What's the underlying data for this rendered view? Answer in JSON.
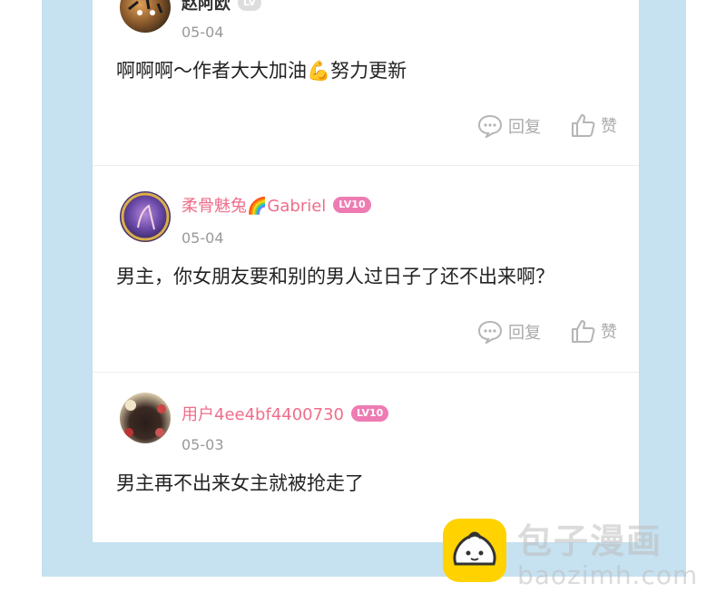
{
  "comments": [
    {
      "username": "赵阿欧",
      "level": "LV",
      "date": "05-04",
      "text": "啊啊啊～作者大大加油💪努力更新",
      "reply_label": "回复",
      "like_label": "赞"
    },
    {
      "username": "柔骨魅兔🌈Gabriel",
      "level": "LV10",
      "date": "05-04",
      "text": "男主，你女朋友要和别的男人过日子了还不出来啊？",
      "reply_label": "回复",
      "like_label": "赞"
    },
    {
      "username": "用户4ee4bf4400730",
      "level": "LV10",
      "date": "05-03",
      "text": "男主再不出来女主就被抢走了"
    }
  ],
  "watermark": {
    "name": "包子漫画",
    "url": "baozimh.com"
  },
  "colors": {
    "frame": "#c6e1f0",
    "username": "#f06d8a",
    "level_badge": "#ee7bb3",
    "logo": "#ffd200"
  }
}
